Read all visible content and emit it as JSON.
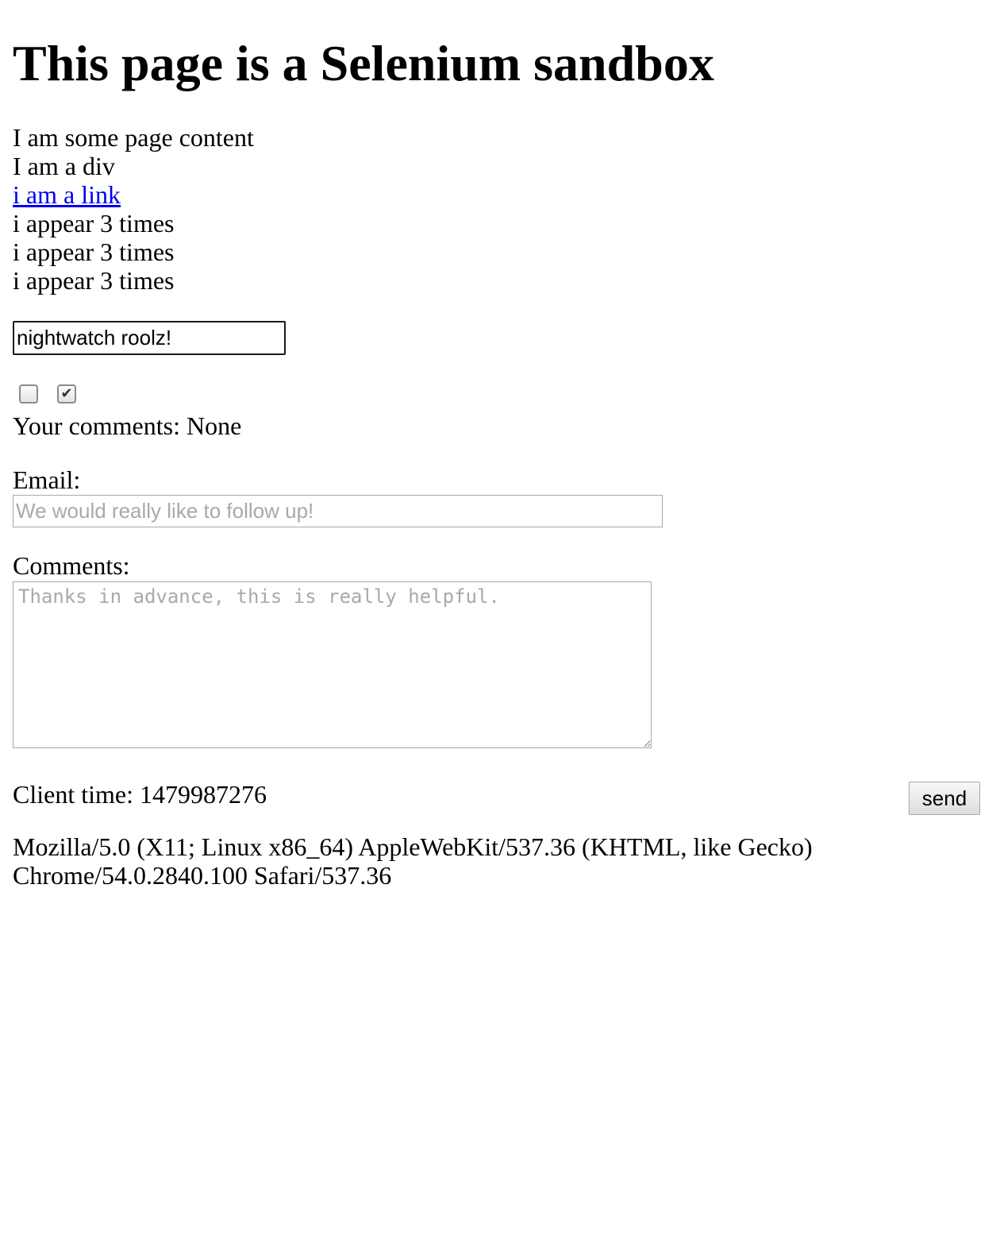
{
  "heading": "This page is a Selenium sandbox",
  "content": {
    "line1": "I am some page content",
    "line2": "I am a div",
    "link": "i am a link",
    "repeat": [
      "i appear 3 times",
      "i appear 3 times",
      "i appear 3 times"
    ]
  },
  "text_input": {
    "value": "nightwatch roolz!"
  },
  "checkboxes": [
    {
      "checked": false
    },
    {
      "checked": true,
      "mark": "✔"
    }
  ],
  "comments_status": "Your comments: None",
  "email": {
    "label": "Email:",
    "placeholder": "We would really like to follow up!"
  },
  "comments": {
    "label": "Comments:",
    "placeholder": "Thanks in advance, this is really helpful."
  },
  "client_time": "Client time: 1479987276",
  "send_label": "send",
  "user_agent": "Mozilla/5.0 (X11; Linux x86_64) AppleWebKit/537.36 (KHTML, like Gecko) Chrome/54.0.2840.100 Safari/537.36"
}
